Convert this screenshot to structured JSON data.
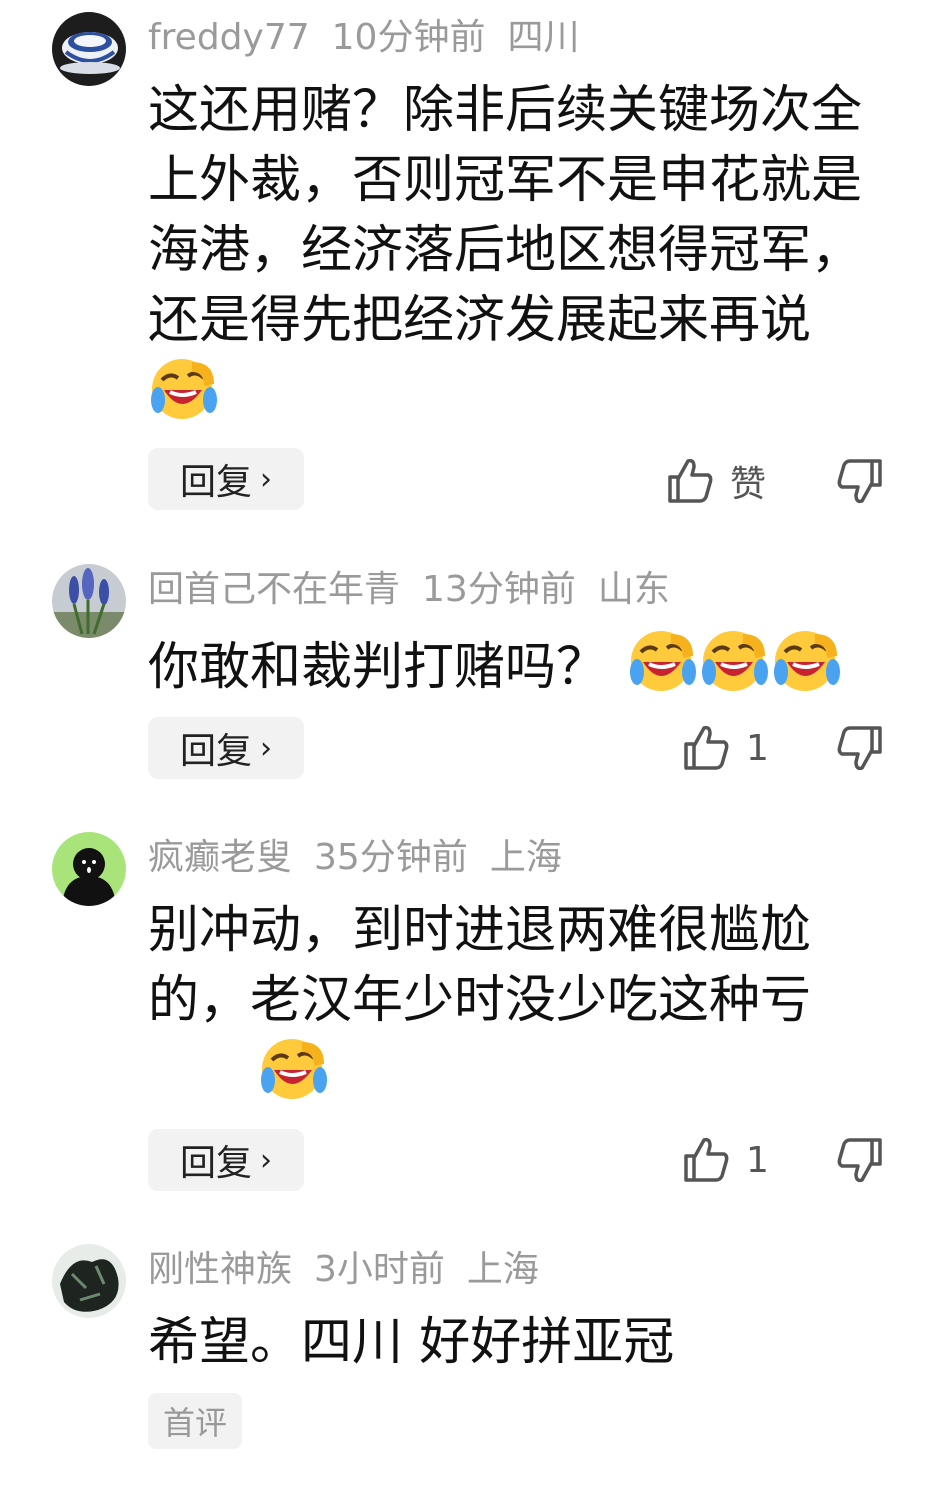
{
  "comments": [
    {
      "user": "freddy77",
      "time": "10分钟前",
      "location": "四川",
      "text": "这还用赌？除非后续关键场次全上外裁，否则冠军不是申花就是海港，经济落后地区想得冠军，还是得先把经济发展起来再说",
      "emoji_icon": "laughing-crying-icon",
      "reply_label": "回复",
      "like_label": "赞"
    },
    {
      "user": "回首己不在年青",
      "time": "13分钟前",
      "location": "山东",
      "text": "你敢和裁判打赌吗？",
      "emoji_icon": "laughing-crying-icon",
      "reply_label": "回复",
      "like_label": "1"
    },
    {
      "user": "疯癫老叟",
      "time": "35分钟前",
      "location": "上海",
      "text": "别冲动，到时进退两难很尴尬的，老汉年少时没少吃这种亏",
      "emoji_icon": "laughing-crying-icon",
      "reply_label": "回复",
      "like_label": "1"
    },
    {
      "user": "刚性神族",
      "time": "3小时前",
      "location": "上海",
      "text": "希望。四川 好好拼亚冠",
      "tag_label": "首评"
    }
  ],
  "colors": {
    "meta": "#9a9a9a",
    "text": "#111111",
    "button_bg": "#f2f2f2",
    "emoji_face": "#ffcb3d",
    "emoji_tear": "#4aa3f0"
  },
  "icons": [
    "avatar",
    "chevron-right-icon",
    "thumbs-up-icon",
    "thumbs-down-icon",
    "laughing-crying-icon"
  ]
}
